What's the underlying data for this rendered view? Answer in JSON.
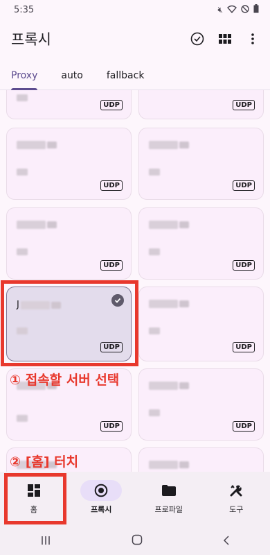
{
  "status_bar": {
    "time": "5:35"
  },
  "app_bar": {
    "title": "프록시"
  },
  "tabs": [
    {
      "label": "Proxy",
      "active": true
    },
    {
      "label": "auto",
      "active": false
    },
    {
      "label": "fallback",
      "active": false
    }
  ],
  "cards": [
    {
      "name_prefix": "",
      "udp": "UDP"
    },
    {
      "name_prefix": "",
      "udp": "UDP"
    },
    {
      "name_prefix": "",
      "udp": "UDP"
    },
    {
      "name_prefix": "",
      "udp": "UDP"
    },
    {
      "name_prefix": "",
      "udp": "UDP"
    },
    {
      "name_prefix": "",
      "udp": "UDP"
    },
    {
      "name_prefix": "J",
      "udp": "UDP",
      "selected": true
    },
    {
      "name_prefix": "",
      "udp": "UDP"
    },
    {
      "name_prefix": "",
      "udp": "UDP"
    },
    {
      "name_prefix": "",
      "udp": "UDP"
    }
  ],
  "annotations": {
    "step1": "① 접속할 서버 선택",
    "step2": "② [홈] 터치"
  },
  "bottom_nav": [
    {
      "label": "홈",
      "icon": "dashboard-icon"
    },
    {
      "label": "프록시",
      "icon": "radio-button-icon",
      "active": true
    },
    {
      "label": "프로파일",
      "icon": "folder-icon"
    },
    {
      "label": "도구",
      "icon": "tools-icon"
    }
  ],
  "colors": {
    "accent": "#5d4c8f",
    "annotation": "#e8382d"
  }
}
